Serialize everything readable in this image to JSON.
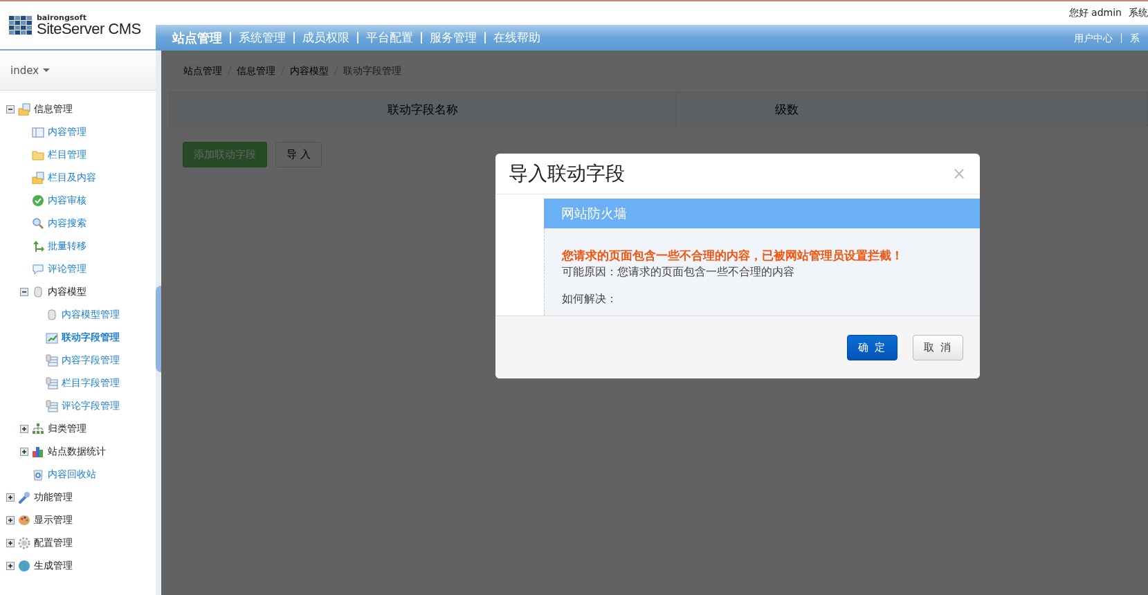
{
  "header": {
    "logo_small": "bairongsoft",
    "logo_name": "SiteServer CMS",
    "greeting": "您好 admin",
    "switch_link": "系统"
  },
  "nav": {
    "items": [
      {
        "label": "站点管理",
        "selected": true
      },
      {
        "label": "系统管理",
        "selected": false
      },
      {
        "label": "成员权限",
        "selected": false
      },
      {
        "label": "平台配置",
        "selected": false
      },
      {
        "label": "服务管理",
        "selected": false
      },
      {
        "label": "在线帮助",
        "selected": false
      }
    ],
    "right_items": [
      "用户中心",
      "系"
    ]
  },
  "sidebar": {
    "site_selector": "index",
    "tree": [
      {
        "label": "信息管理",
        "kind": "group",
        "expanded": true,
        "selected": false,
        "children": [
          {
            "label": "内容管理",
            "kind": "link",
            "selected": false
          },
          {
            "label": "栏目管理",
            "kind": "link",
            "selected": false
          },
          {
            "label": "栏目及内容",
            "kind": "link",
            "selected": false
          },
          {
            "label": "内容审核",
            "kind": "link",
            "selected": false
          },
          {
            "label": "内容搜索",
            "kind": "link",
            "selected": false
          },
          {
            "label": "批量转移",
            "kind": "link",
            "selected": false
          },
          {
            "label": "评论管理",
            "kind": "link",
            "selected": false
          },
          {
            "label": "内容模型",
            "kind": "group",
            "expanded": true,
            "selected": false,
            "children": [
              {
                "label": "内容模型管理",
                "kind": "link",
                "selected": false
              },
              {
                "label": "联动字段管理",
                "kind": "link",
                "selected": true
              },
              {
                "label": "内容字段管理",
                "kind": "link",
                "selected": false
              },
              {
                "label": "栏目字段管理",
                "kind": "link",
                "selected": false
              },
              {
                "label": "评论字段管理",
                "kind": "link",
                "selected": false
              }
            ]
          },
          {
            "label": "归类管理",
            "kind": "group",
            "expanded": false,
            "selected": false
          },
          {
            "label": "站点数据统计",
            "kind": "group",
            "expanded": false,
            "selected": false
          },
          {
            "label": "内容回收站",
            "kind": "link",
            "selected": false
          }
        ]
      },
      {
        "label": "功能管理",
        "kind": "group",
        "expanded": false,
        "selected": false
      },
      {
        "label": "显示管理",
        "kind": "group",
        "expanded": false,
        "selected": false
      },
      {
        "label": "配置管理",
        "kind": "group",
        "expanded": false,
        "selected": false
      },
      {
        "label": "生成管理",
        "kind": "group",
        "expanded": false,
        "selected": false
      }
    ]
  },
  "breadcrumb": [
    "站点管理",
    "信息管理",
    "内容模型",
    "联动字段管理"
  ],
  "table": {
    "columns": [
      "联动字段名称",
      "级数"
    ]
  },
  "actions": [
    {
      "label": "添加联动字段",
      "kind": "primary"
    },
    {
      "label": "导 入",
      "kind": "default"
    }
  ],
  "dialog": {
    "title": "导入联动字段",
    "close": "×",
    "panel_title": "网站防火墙",
    "alert": "您请求的页面包含一些不合理的内容，已被网站管理员设置拦截！",
    "reason": "可能原因：您请求的页面包含一些不合理的内容",
    "solution": "如何解决：",
    "buttons": [
      {
        "label": "确 定",
        "kind": "primary"
      },
      {
        "label": "取 消",
        "kind": "default"
      }
    ]
  }
}
